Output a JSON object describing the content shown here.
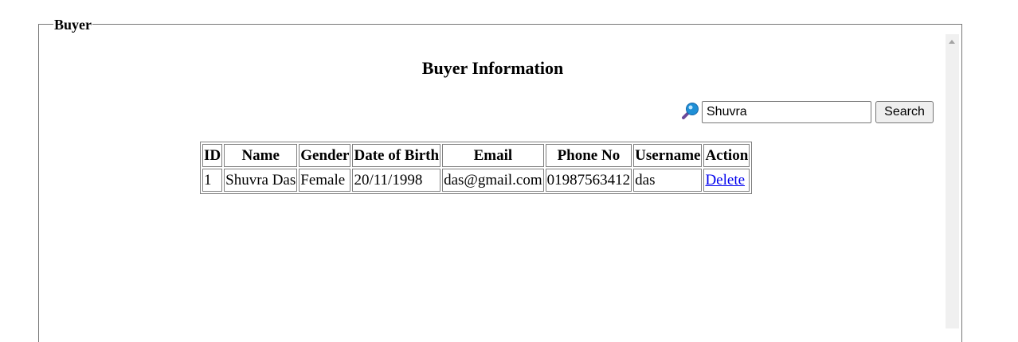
{
  "fieldset": {
    "legend": "Buyer"
  },
  "page": {
    "title": "Buyer Information"
  },
  "search": {
    "icon": "search-icon",
    "value": "Shuvra",
    "button_label": "Search"
  },
  "table": {
    "headers": [
      "ID",
      "Name",
      "Gender",
      "Date of Birth",
      "Email",
      "Phone No",
      "Username",
      "Action"
    ],
    "rows": [
      {
        "id": "1",
        "name": "Shuvra Das",
        "gender": "Female",
        "dob": "20/11/1998",
        "email": "das@gmail.com",
        "phone": "01987563412",
        "username": "das",
        "action": "Delete"
      }
    ]
  },
  "colors": {
    "link": "#0000ee",
    "border": "#808080"
  }
}
